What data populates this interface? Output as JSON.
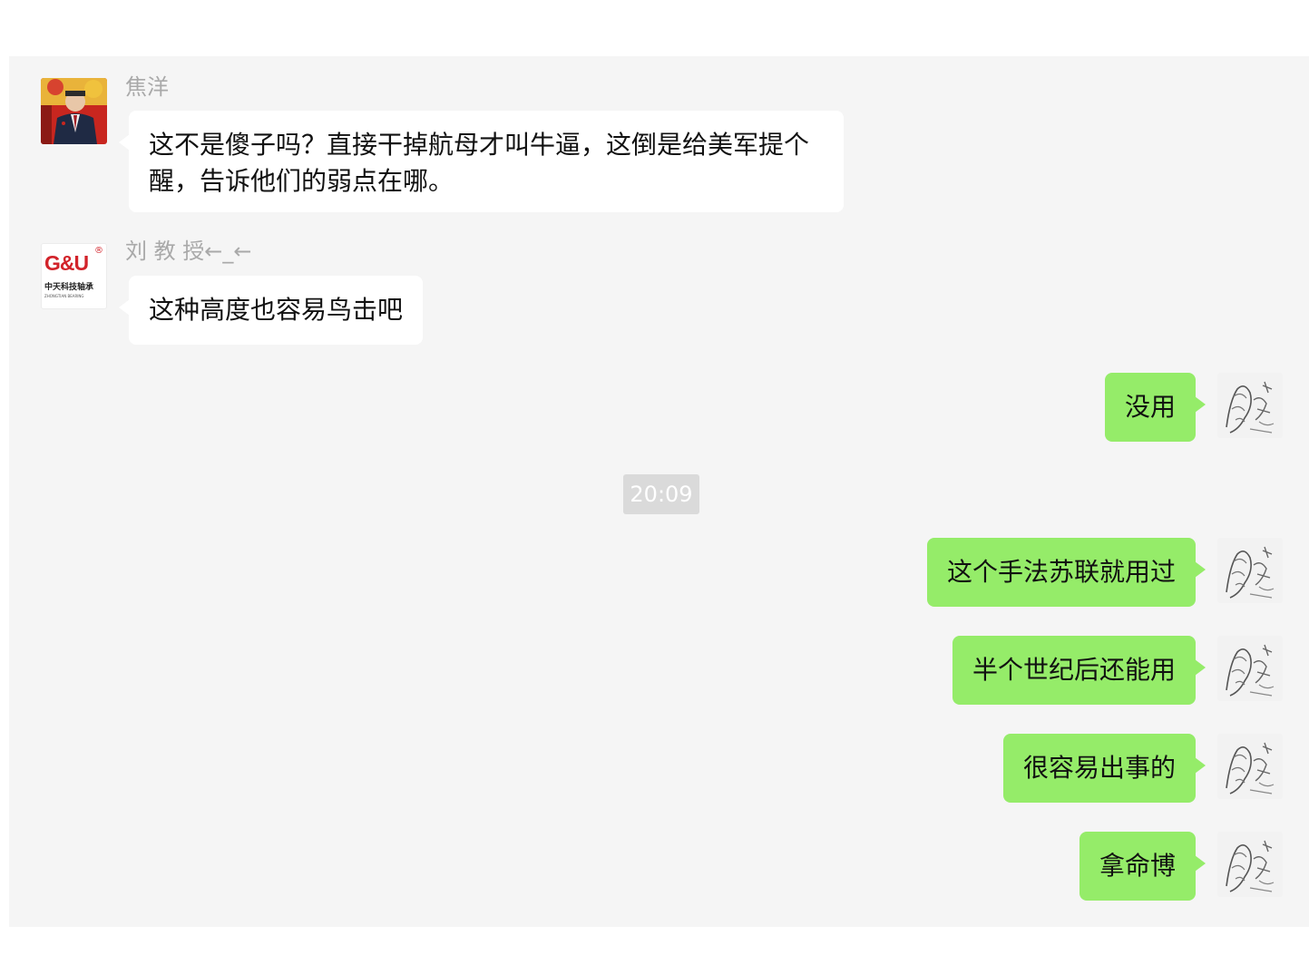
{
  "messages": [
    {
      "sender": "焦洋",
      "text": "这不是傻子吗？直接干掉航母才叫牛逼，这倒是给美军提个醒，告诉他们的弱点在哪。"
    },
    {
      "sender": "刘 教 授←_←",
      "text": "这种高度也容易鸟击吧"
    },
    {
      "sender": "me",
      "text": "没用"
    },
    {
      "sender": "me",
      "text": "这个手法苏联就用过"
    },
    {
      "sender": "me",
      "text": "半个世纪后还能用"
    },
    {
      "sender": "me",
      "text": "很容易出事的"
    },
    {
      "sender": "me",
      "text": "拿命博"
    }
  ],
  "timestamp": "20:09",
  "avatar_logo": {
    "mark": "G&U",
    "registered": "®",
    "company": "中天科技轴承",
    "subline": "ZHONGTIAN BEARING"
  },
  "colors": {
    "panel_background": "#f5f5f5",
    "incoming_bubble": "#ffffff",
    "outgoing_bubble": "#95ec69",
    "timestamp_background": "#dadada",
    "sender_name": "#a9a9a9",
    "logo_red": "#d2232a"
  },
  "icons": {
    "sender1_avatar": "portrait-photo-avatar",
    "sender2_avatar": "company-logo-avatar",
    "my_avatar": "sketch-drawing-avatar"
  }
}
